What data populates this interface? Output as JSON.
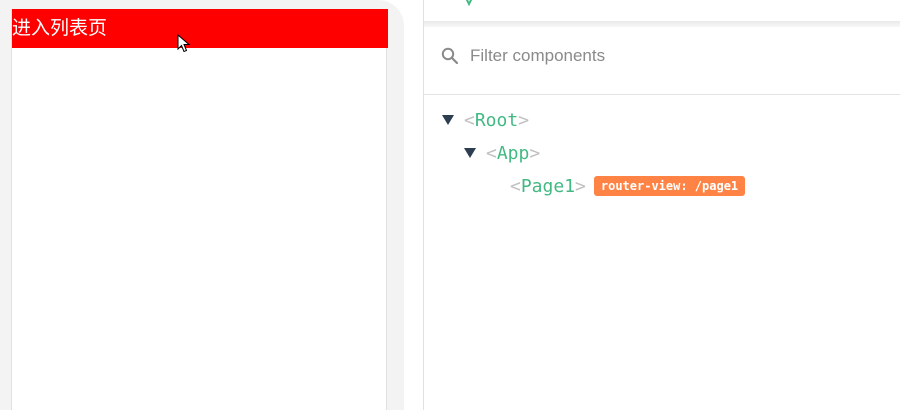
{
  "app": {
    "link_text": "进入列表页",
    "bar_color": "#ff0000"
  },
  "devtools": {
    "filter": {
      "placeholder": "Filter components",
      "value": ""
    },
    "tree": [
      {
        "name": "Root",
        "expanded": true,
        "depth": 0
      },
      {
        "name": "App",
        "expanded": true,
        "depth": 1
      },
      {
        "name": "Page1",
        "expanded": false,
        "depth": 2,
        "badge": "router-view: /page1"
      }
    ],
    "accent_color": "#42b983",
    "badge_color": "#ff8344"
  }
}
